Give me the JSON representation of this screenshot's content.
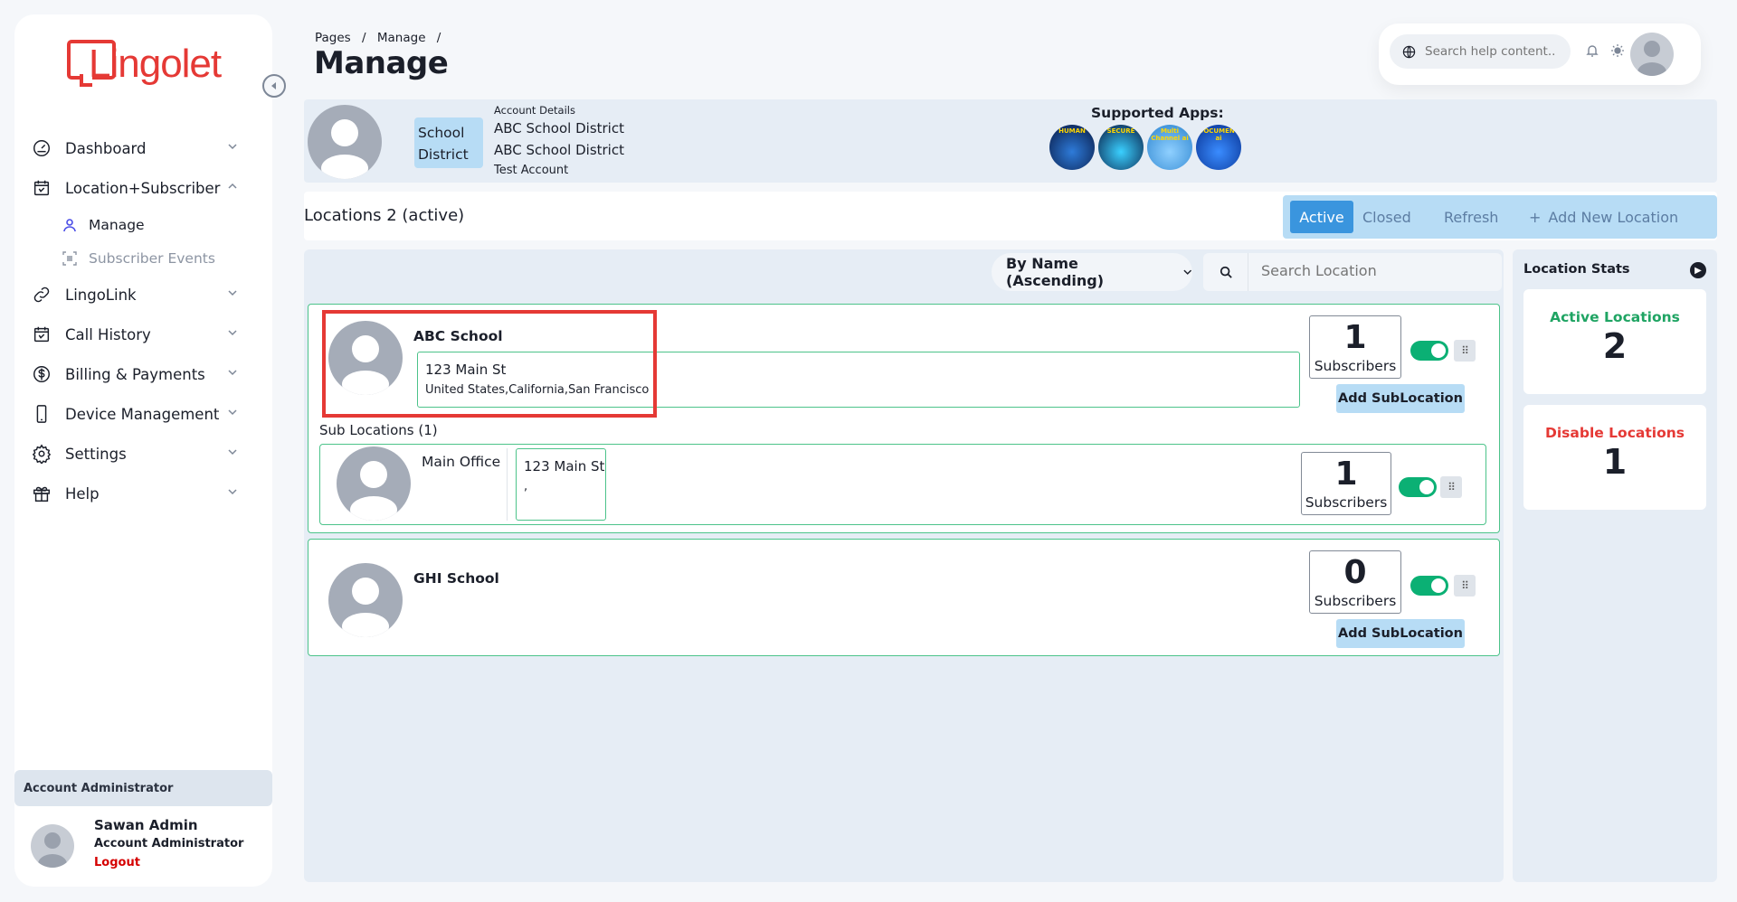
{
  "brand": {
    "name": "Lingolet",
    "color": "#e53935"
  },
  "sidebar": {
    "items": [
      {
        "label": "Dashboard",
        "icon": "dashboard-icon"
      },
      {
        "label": "Location+Subscriber",
        "icon": "calendar-icon",
        "expanded": true,
        "children": [
          {
            "label": "Manage",
            "icon": "user-icon",
            "active": true
          },
          {
            "label": "Subscriber Events",
            "icon": "events-icon"
          }
        ]
      },
      {
        "label": "LingoLink",
        "icon": "link-icon"
      },
      {
        "label": "Call History",
        "icon": "calendar-icon"
      },
      {
        "label": "Billing & Payments",
        "icon": "dollar-icon"
      },
      {
        "label": "Device Management",
        "icon": "device-icon"
      },
      {
        "label": "Settings",
        "icon": "gear-icon"
      },
      {
        "label": "Help",
        "icon": "gift-icon"
      }
    ],
    "account_band": "Account Administrator",
    "user": {
      "name": "Sawan Admin",
      "role": "Account Administrator",
      "logout": "Logout"
    }
  },
  "header": {
    "breadcrumb": [
      "Pages",
      "/",
      "Manage",
      "/"
    ],
    "title": "Manage",
    "search_placeholder": "Search help content.."
  },
  "account": {
    "type_line1": "School",
    "type_line2": "District",
    "details_label": "Account Details",
    "name1": "ABC School District",
    "name2": "ABC School District",
    "note": "Test Account",
    "apps_title": "Supported Apps:",
    "apps": [
      {
        "label": "HUMAN",
        "color": "#0b2a6b"
      },
      {
        "label": "SECURE",
        "color": "#07163f"
      },
      {
        "label": "Multi Channel ai",
        "color": "#4aa8e8"
      },
      {
        "label": "DOCUMENT ai",
        "color": "#0a47c2"
      }
    ]
  },
  "locations": {
    "title": "Locations 2 (active)",
    "filters": {
      "active": "Active",
      "closed": "Closed",
      "refresh": "Refresh",
      "add": "Add New Location"
    },
    "sort_label": "By Name (Ascending)",
    "search_placeholder": "Search Location",
    "list": [
      {
        "name": "ABC School",
        "address1": "123 Main St",
        "address2": "United States,California,San Francisco",
        "subscribers": "1",
        "subscribers_label": "Subscribers",
        "add_sub": "Add SubLocation",
        "sub_heading": "Sub Locations (1)",
        "sublocations": [
          {
            "name": "Main Office",
            "address1": "123 Main St",
            "address2": ",",
            "subscribers": "1",
            "subscribers_label": "Subscribers"
          }
        ]
      },
      {
        "name": "GHI School",
        "subscribers": "0",
        "subscribers_label": "Subscribers",
        "add_sub": "Add SubLocation"
      }
    ]
  },
  "stats": {
    "title": "Location Stats",
    "active": {
      "label": "Active Locations",
      "value": "2",
      "color": "#1fa463"
    },
    "disabled": {
      "label": "Disable Locations",
      "value": "1",
      "color": "#e53935"
    }
  }
}
